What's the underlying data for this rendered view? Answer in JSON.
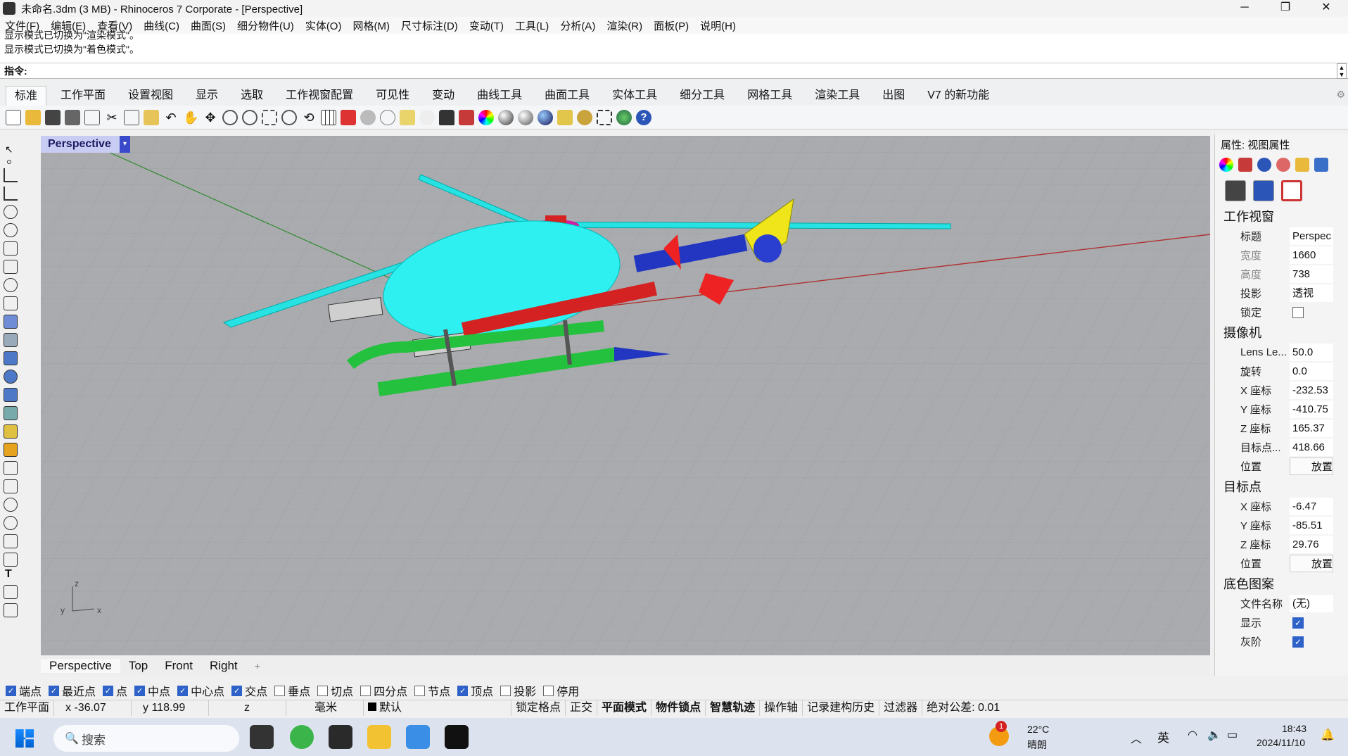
{
  "window": {
    "title": "未命名.3dm (3 MB) - Rhinoceros 7 Corporate - [Perspective]",
    "minimize": "─",
    "maximize": "❐",
    "close": "✕"
  },
  "menu": [
    "文件(F)",
    "编辑(E)",
    "查看(V)",
    "曲线(C)",
    "曲面(S)",
    "细分物件(U)",
    "实体(O)",
    "网格(M)",
    "尺寸标注(D)",
    "变动(T)",
    "工具(L)",
    "分析(A)",
    "渲染(R)",
    "面板(P)",
    "说明(H)"
  ],
  "history": {
    "line1": "显示模式已切换为\"渲染模式\"。",
    "line2": "显示模式已切换为\"着色模式\"。"
  },
  "command": {
    "label": "指令:"
  },
  "tabs": [
    "标准",
    "工作平面",
    "设置视图",
    "显示",
    "选取",
    "工作视窗配置",
    "可见性",
    "变动",
    "曲线工具",
    "曲面工具",
    "实体工具",
    "细分工具",
    "网格工具",
    "渲染工具",
    "出图",
    "V7 的新功能"
  ],
  "viewport": {
    "name": "Perspective",
    "axes": {
      "x": "x",
      "y": "y",
      "z": "z"
    }
  },
  "viewport_tabs": [
    "Perspective",
    "Top",
    "Front",
    "Right"
  ],
  "properties": {
    "header": "属性: 视图属性",
    "viewport_section": "工作视窗",
    "viewport_rows": [
      {
        "k": "标题",
        "v": "Perspec"
      },
      {
        "k": "宽度",
        "v": "1660"
      },
      {
        "k": "高度",
        "v": "738"
      },
      {
        "k": "投影",
        "v": "透视"
      }
    ],
    "lock_label": "锁定",
    "camera_section": "摄像机",
    "camera_rows": [
      {
        "k": "Lens Le...",
        "v": "50.0"
      },
      {
        "k": "旋转",
        "v": "0.0"
      },
      {
        "k": "X 座标",
        "v": "-232.53"
      },
      {
        "k": "Y 座标",
        "v": "-410.75"
      },
      {
        "k": "Z 座标",
        "v": "165.37"
      },
      {
        "k": "目标点...",
        "v": "418.66"
      }
    ],
    "position_label": "位置",
    "place_button": "放置",
    "target_section": "目标点",
    "target_rows": [
      {
        "k": "X 座标",
        "v": "-6.47"
      },
      {
        "k": "Y 座标",
        "v": "-85.51"
      },
      {
        "k": "Z 座标",
        "v": "29.76"
      }
    ],
    "wallpaper_section": "底色图案",
    "filename_label": "文件名称",
    "filename_value": "(无)",
    "show_label": "显示",
    "gray_label": "灰阶"
  },
  "osnaps": [
    {
      "label": "端点",
      "checked": true
    },
    {
      "label": "最近点",
      "checked": true
    },
    {
      "label": "点",
      "checked": true
    },
    {
      "label": "中点",
      "checked": true
    },
    {
      "label": "中心点",
      "checked": true
    },
    {
      "label": "交点",
      "checked": true
    },
    {
      "label": "垂点",
      "checked": false
    },
    {
      "label": "切点",
      "checked": false
    },
    {
      "label": "四分点",
      "checked": false
    },
    {
      "label": "节点",
      "checked": false
    },
    {
      "label": "顶点",
      "checked": true
    },
    {
      "label": "投影",
      "checked": false
    },
    {
      "label": "停用",
      "checked": false
    }
  ],
  "status": {
    "cplane": "工作平面",
    "x": "x -36.07",
    "y": "y 118.99",
    "z": "z",
    "unit": "毫米",
    "layer": "默认",
    "grid_snap": "锁定格点",
    "ortho": "正交",
    "planar": "平面模式",
    "osnap": "物件锁点",
    "smarttrack": "智慧轨迹",
    "gumball": "操作轴",
    "history": "记录建构历史",
    "filter": "过滤器",
    "tolerance": "绝对公差: 0.01"
  },
  "taskbar": {
    "search": "搜索",
    "weather_temp": "22°C",
    "weather_desc": "晴朗",
    "weather_badge": "1",
    "ime": "英",
    "time": "18:43",
    "date": "2024/11/10"
  }
}
